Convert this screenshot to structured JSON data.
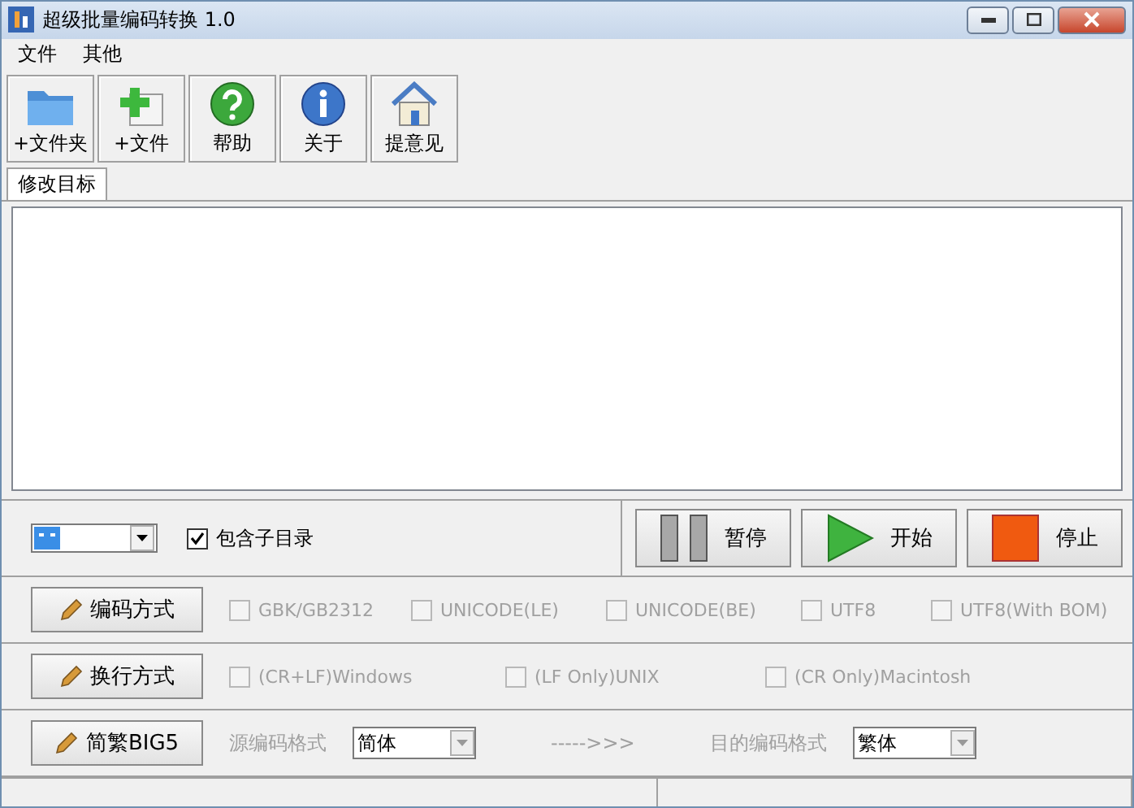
{
  "window": {
    "title": "超级批量编码转换 1.0"
  },
  "menu": [
    "文件",
    "其他"
  ],
  "toolbar": [
    {
      "kind": "folder",
      "label": "+文件夹"
    },
    {
      "kind": "file",
      "label": "+文件"
    },
    {
      "kind": "help",
      "label": "帮助"
    },
    {
      "kind": "info",
      "label": "关于"
    },
    {
      "kind": "home",
      "label": "提意见"
    }
  ],
  "tabs": [
    {
      "label": "修改目标",
      "selected": true
    }
  ],
  "controls": {
    "subdirs": {
      "label": "包含子目录",
      "checked": true
    },
    "buttons": [
      {
        "kind": "pause",
        "label": "暂停"
      },
      {
        "kind": "start",
        "label": "开始"
      },
      {
        "kind": "stop",
        "label": "停止"
      }
    ]
  },
  "rows": [
    {
      "button": "编码方式",
      "kind": "checks",
      "options": [
        {
          "label": "GBK/GB2312",
          "checked": false,
          "disabled": true
        },
        {
          "label": "UNICODE(LE)",
          "checked": false,
          "disabled": true
        },
        {
          "label": "UNICODE(BE)",
          "checked": false,
          "disabled": true
        },
        {
          "label": "UTF8",
          "checked": false,
          "disabled": true
        },
        {
          "label": "UTF8(With BOM)",
          "checked": false,
          "disabled": true
        }
      ]
    },
    {
      "button": "换行方式",
      "kind": "checks",
      "options": [
        {
          "label": "(CR+LF)Windows",
          "checked": false,
          "disabled": true
        },
        {
          "label": "(LF Only)UNIX",
          "checked": false,
          "disabled": true
        },
        {
          "label": "(CR Only)Macintosh",
          "checked": false,
          "disabled": true
        }
      ]
    },
    {
      "button": "简繁BIG5",
      "kind": "convert",
      "source_label": "源编码格式",
      "source": "简体",
      "arrow": "----->>>",
      "target_label": "目的编码格式",
      "target": "繁体"
    }
  ]
}
